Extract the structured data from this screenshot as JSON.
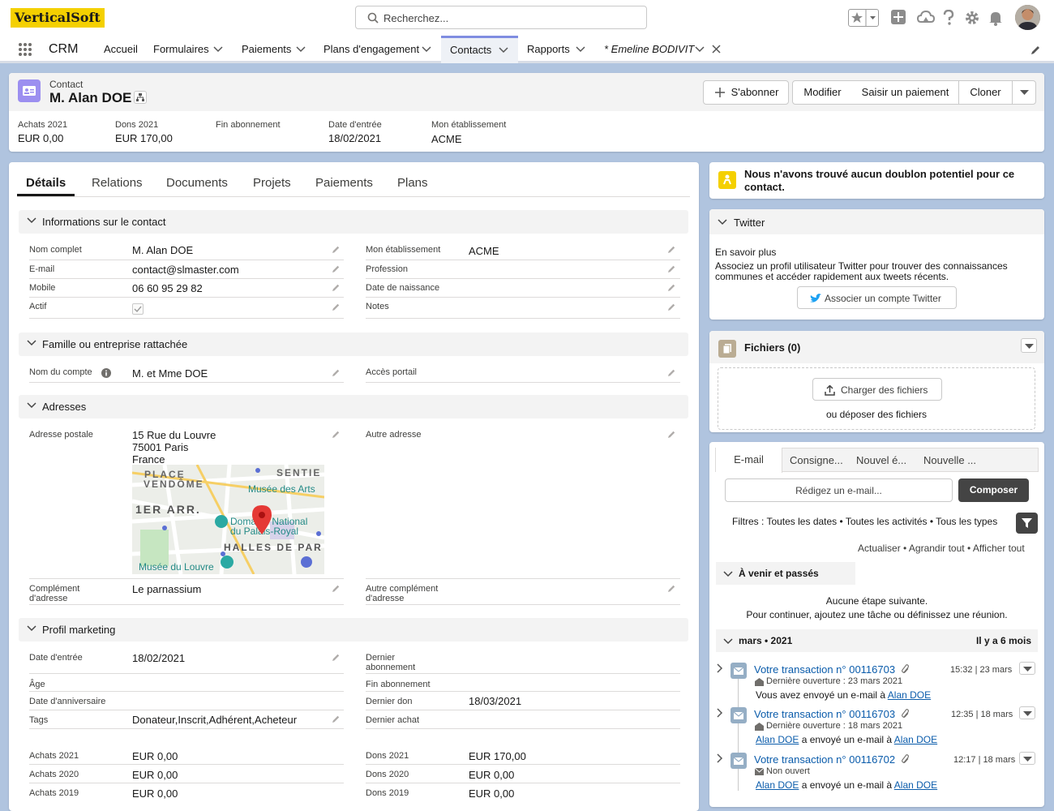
{
  "app": {
    "logo": "VerticalSoft",
    "search_placeholder": "Recherchez...",
    "name": "CRM"
  },
  "nav": {
    "items": [
      "Accueil",
      "Formulaires",
      "Paiements",
      "Plans d'engagement",
      "Contacts",
      "Rapports"
    ],
    "open_tab": "* Emeline BODIVIT"
  },
  "header": {
    "object": "Contact",
    "name": "M. Alan DOE",
    "buttons": {
      "subscribe": "S'abonner",
      "edit": "Modifier",
      "payment": "Saisir un paiement",
      "clone": "Cloner"
    },
    "fields": [
      {
        "label": "Achats 2021",
        "value": "EUR 0,00"
      },
      {
        "label": "Dons 2021",
        "value": "EUR 170,00"
      },
      {
        "label": "Fin abonnement",
        "value": ""
      },
      {
        "label": "Date d'entrée",
        "value": "18/02/2021"
      },
      {
        "label": "Mon établissement",
        "value": "ACME"
      }
    ]
  },
  "tabs": [
    "Détails",
    "Relations",
    "Documents",
    "Projets",
    "Paiements",
    "Plans"
  ],
  "sections": {
    "contact_info": {
      "title": "Informations sur le contact",
      "left": [
        {
          "label": "Nom complet",
          "value": "M. Alan DOE"
        },
        {
          "label": "E-mail",
          "value": "contact@slmaster.com"
        },
        {
          "label": "Mobile",
          "value": "06 60 95 29 82"
        },
        {
          "label": "Actif",
          "value": ""
        }
      ],
      "right": [
        {
          "label": "Mon établissement",
          "value": "ACME"
        },
        {
          "label": "Profession",
          "value": ""
        },
        {
          "label": "Date de naissance",
          "value": ""
        },
        {
          "label": "Notes",
          "value": ""
        }
      ]
    },
    "family": {
      "title": "Famille ou entreprise rattachée",
      "account_label": "Nom du compte",
      "account_value": "M. et Mme DOE",
      "portal_label": "Accès portail"
    },
    "addresses": {
      "title": "Adresses",
      "postal_label": "Adresse postale",
      "postal_lines": [
        "15 Rue du Louvre",
        "75001 Paris",
        "France"
      ],
      "other_label": "Autre adresse",
      "map_labels": [
        "PLACE",
        "VENDÔME",
        "SENTIE",
        "Musée des Arts",
        "1ER ARR.",
        "Domaine National",
        "du Palais-Royal",
        "HALLES DE PAR",
        "Musée du Louvre"
      ],
      "complement_label": "Complément d'adresse",
      "complement_value": "Le parnassium",
      "other_complement_label": "Autre complément d'adresse"
    },
    "marketing": {
      "title": "Profil marketing",
      "left": [
        {
          "label": "Date d'entrée",
          "value": "18/02/2021"
        },
        {
          "label": "Âge",
          "value": ""
        },
        {
          "label": "Date d'anniversaire",
          "value": ""
        },
        {
          "label": "Tags",
          "value": "Donateur,Inscrit,Adhérent,Acheteur"
        }
      ],
      "right": [
        {
          "label": "Dernier abonnement",
          "value": ""
        },
        {
          "label": "Fin abonnement",
          "value": ""
        },
        {
          "label": "Dernier don",
          "value": "18/03/2021"
        },
        {
          "label": "Dernier achat",
          "value": ""
        }
      ],
      "purchases": [
        {
          "label": "Achats 2021",
          "value": "EUR 0,00"
        },
        {
          "label": "Achats 2020",
          "value": "EUR 0,00"
        },
        {
          "label": "Achats 2019",
          "value": "EUR 0,00"
        }
      ],
      "donations": [
        {
          "label": "Dons 2021",
          "value": "EUR 170,00"
        },
        {
          "label": "Dons 2020",
          "value": "EUR 0,00"
        },
        {
          "label": "Dons 2019",
          "value": "EUR 0,00"
        }
      ]
    }
  },
  "duplicates": {
    "text": "Nous n'avons trouvé aucun doublon potentiel pour ce contact."
  },
  "twitter": {
    "title": "Twitter",
    "learn": "En savoir plus",
    "desc": "Associez un profil utilisateur Twitter pour trouver des connaissances communes et accéder rapidement aux tweets récents.",
    "button": "Associer un compte Twitter"
  },
  "files": {
    "title": "Fichiers (0)",
    "upload": "Charger des fichiers",
    "drop": "ou déposer des fichiers"
  },
  "activity": {
    "tabs": [
      "E-mail",
      "Consigne...",
      "Nouvel é...",
      "Nouvelle ..."
    ],
    "compose_placeholder": "Rédigez un e-mail...",
    "compose_button": "Composer",
    "filters": "Filtres : Toutes les dates • Toutes les activités • Tous les types",
    "actions": [
      "Actualiser",
      "Agrandir tout",
      "Afficher tout"
    ],
    "upcoming": "À venir et passés",
    "no_step": "Aucune étape suivante.",
    "no_step_hint": "Pour continuer, ajoutez une tâche ou définissez une réunion.",
    "month": "mars • 2021",
    "month_ago": "Il y a 6 mois",
    "items": [
      {
        "title": "Votre transaction n° 00116703",
        "time": "15:32 | 23 mars",
        "status": "Dernière ouverture : 23 mars 2021",
        "line_prefix": "Vous avez envoyé un e-mail à",
        "line_from": "",
        "line_to": "Alan DOE"
      },
      {
        "title": "Votre transaction n° 00116703",
        "time": "12:35 | 18 mars",
        "status": "Dernière ouverture : 18 mars 2021",
        "line_prefix": "a envoyé un e-mail à",
        "line_from": "Alan DOE",
        "line_to": "Alan DOE"
      },
      {
        "title": "Votre transaction n° 00116702",
        "time": "12:17 | 18 mars",
        "status": "Non ouvert",
        "line_prefix": "a envoyé un e-mail à",
        "line_from": "Alan DOE",
        "line_to": "Alan DOE"
      }
    ]
  },
  "colors": {
    "accent": "#0b5cab",
    "brand_yellow": "#f4d000",
    "contact_icon": "#9c8ff0",
    "background": "#b0c4df",
    "compose": "#444444"
  }
}
